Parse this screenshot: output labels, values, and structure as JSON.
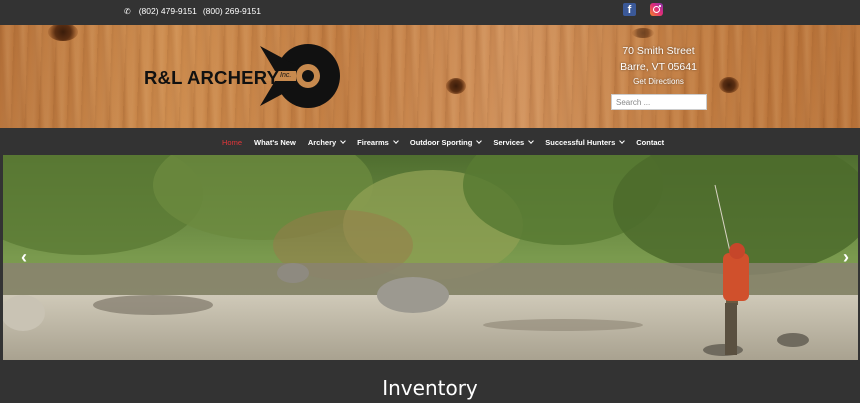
{
  "topbar": {
    "phone_1": "(802) 479-9151",
    "phone_2": "(800) 269-9151",
    "phone_icon": "phone-icon",
    "social": [
      {
        "name": "facebook",
        "icon": "facebook-icon",
        "glyph": "f",
        "color": "#3b5998"
      },
      {
        "name": "instagram",
        "icon": "instagram-icon"
      }
    ]
  },
  "header": {
    "logo_text": "R&L ARCHERY",
    "logo_suffix": "Inc.",
    "address_line_1": "70 Smith Street",
    "address_line_2": "Barre, VT 05641",
    "directions_label": "Get Directions",
    "search_placeholder": "Search ..."
  },
  "nav": {
    "items": [
      {
        "label": "Home",
        "active": true
      },
      {
        "label": "What's New"
      },
      {
        "label": "Archery",
        "dropdown": true
      },
      {
        "label": "Firearms",
        "dropdown": true
      },
      {
        "label": "Outdoor Sporting",
        "dropdown": true
      },
      {
        "label": "Services",
        "dropdown": true
      },
      {
        "label": "Successful Hunters",
        "dropdown": true
      },
      {
        "label": "Contact"
      }
    ]
  },
  "hero": {
    "prev_icon": "chevron-left-icon",
    "next_icon": "chevron-right-icon",
    "prev_glyph": "‹",
    "next_glyph": "›"
  },
  "section": {
    "title": "Inventory"
  },
  "colors": {
    "bar_bg": "#333333",
    "active_nav": "#e2363a",
    "text": "#ffffff"
  }
}
